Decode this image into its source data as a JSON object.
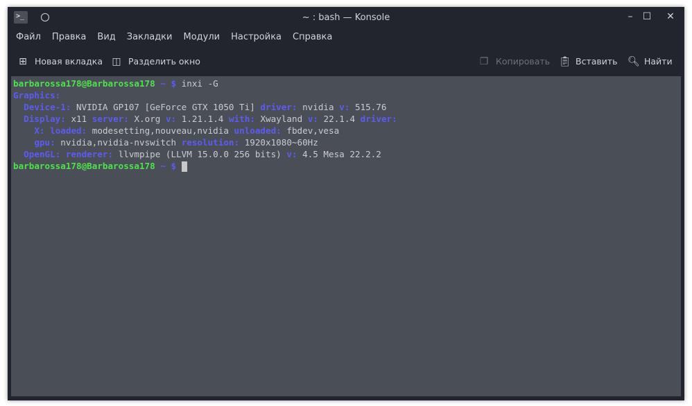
{
  "window": {
    "title": "~ : bash — Konsole"
  },
  "menu": [
    "Файл",
    "Правка",
    "Вид",
    "Закладки",
    "Модули",
    "Настройка",
    "Справка"
  ],
  "toolbar": {
    "new_tab": "Новая вкладка",
    "split": "Разделить окно",
    "copy": "Копировать",
    "paste": "Вставить",
    "find": "Найти"
  },
  "terminal": {
    "prompt_user": "barbarossa178@Barbarossa178",
    "prompt_path": "~ $",
    "command": "inxi -G",
    "graphics": "Graphics:",
    "l1": {
      "k1": "Device-1:",
      "v1": "NVIDIA GP107 [GeForce GTX 1050 Ti]",
      "k2": "driver:",
      "v2": "nvidia",
      "k3": "v:",
      "v3": "515.76"
    },
    "l2": {
      "k1": "Display:",
      "v1": "x11",
      "k2": "server:",
      "v2": "X.org",
      "k3": "v:",
      "v3": "1.21.1.4",
      "k4": "with:",
      "v4": "Xwayland",
      "k5": "v:",
      "v5": "22.1.4",
      "k6": "driver:"
    },
    "l3": {
      "k1": "X:",
      "k2": "loaded:",
      "v2": "modesetting,nouveau,nvidia",
      "k3": "unloaded:",
      "v3": "fbdev,vesa"
    },
    "l4": {
      "k1": "gpu:",
      "v1": "nvidia,nvidia-nvswitch",
      "k2": "resolution:",
      "v2": "1920x1080~60Hz"
    },
    "l5": {
      "k1": "OpenGL:",
      "k2": "renderer:",
      "v2": "llvmpipe (LLVM 15.0.0 256 bits)",
      "k3": "v:",
      "v3": "4.5 Mesa 22.2.2"
    }
  }
}
